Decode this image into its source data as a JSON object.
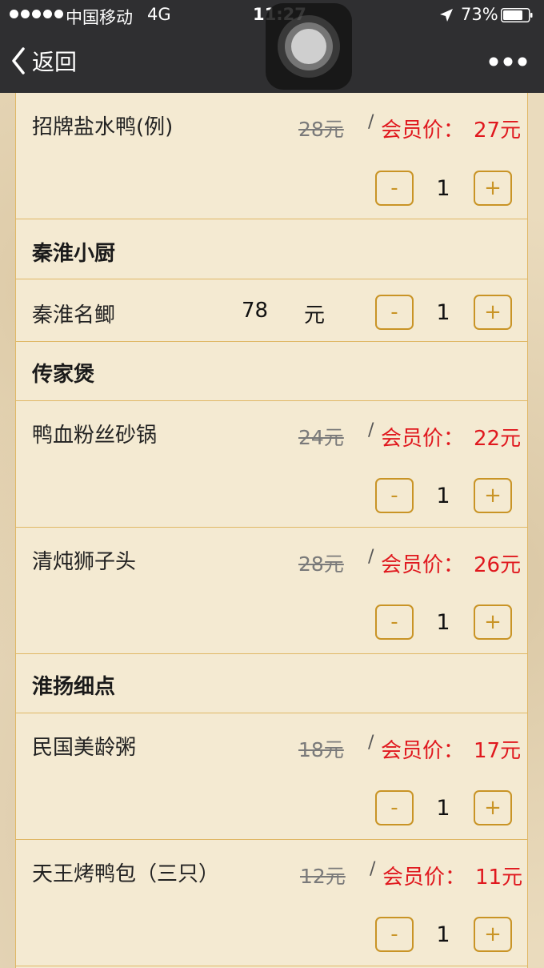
{
  "status_bar": {
    "carrier": "中国移动",
    "network": "4G",
    "time": "11:27",
    "battery": "73%"
  },
  "nav": {
    "back_label": "返回"
  },
  "icons": {
    "back": "chevron-left-icon",
    "more": "more-dots-icon",
    "location": "location-arrow-icon",
    "battery": "battery-icon",
    "assistive": "assistive-touch-icon"
  },
  "colors": {
    "accent": "#c99426",
    "member_price": "#e0181e",
    "header_bg": "#2f2f31"
  },
  "menu": {
    "items": [
      {
        "type": "dish",
        "name": "招牌盐水鸭(例)",
        "original_price": "28元",
        "slash": "/",
        "member_label": "会员价：",
        "member_price": "27元",
        "qty": "1",
        "minus": "-",
        "plus": "+"
      },
      {
        "type": "category",
        "title": "秦淮小厨"
      },
      {
        "type": "dish_plain",
        "name": "秦淮名鲫",
        "price": "78",
        "unit": "元",
        "qty": "1",
        "minus": "-",
        "plus": "+"
      },
      {
        "type": "category",
        "title": "传家煲"
      },
      {
        "type": "dish",
        "name": "鸭血粉丝砂锅",
        "original_price": "24元",
        "slash": "/",
        "member_label": "会员价：",
        "member_price": "22元",
        "qty": "1",
        "minus": "-",
        "plus": "+"
      },
      {
        "type": "dish",
        "name": "清炖狮子头",
        "original_price": "28元",
        "slash": "/",
        "member_label": "会员价：",
        "member_price": "26元",
        "qty": "1",
        "minus": "-",
        "plus": "+"
      },
      {
        "type": "category",
        "title": "淮扬细点"
      },
      {
        "type": "dish",
        "name": "民国美龄粥",
        "original_price": "18元",
        "slash": "/",
        "member_label": "会员价：",
        "member_price": "17元",
        "qty": "1",
        "minus": "-",
        "plus": "+"
      },
      {
        "type": "dish",
        "name": "天王烤鸭包（三只）",
        "original_price": "12元",
        "slash": "/",
        "member_label": "会员价：",
        "member_price": "11元",
        "qty": "1",
        "minus": "-",
        "plus": "+"
      }
    ]
  }
}
